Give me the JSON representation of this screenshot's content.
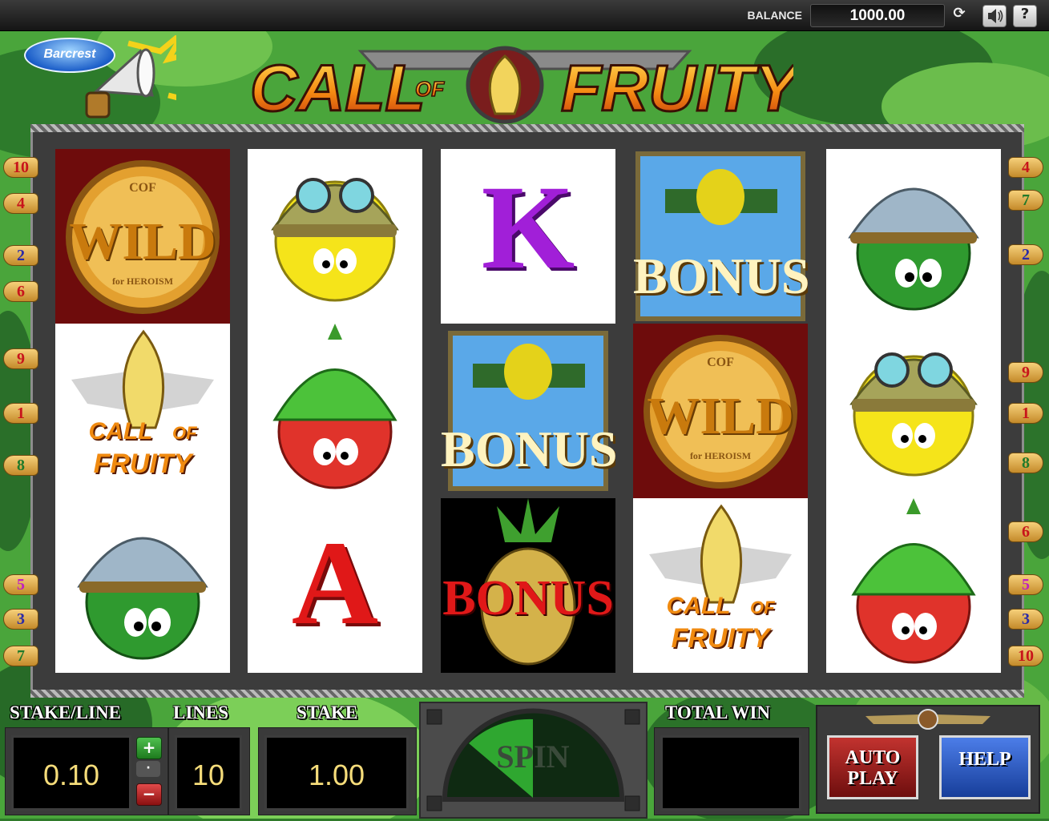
{
  "topbar": {
    "balance_label": "BALANCE",
    "balance_value": "1000.00",
    "icons": [
      "refresh-icon",
      "sound-icon",
      "help-icon"
    ]
  },
  "branding": {
    "provider_logo": "Barcrest",
    "game_title_part1": "CALL",
    "game_title_part2": "OF",
    "game_title_part3": "FRUITY"
  },
  "reels": [
    [
      "wild",
      "call-of-fruity",
      "watermelon-soldier"
    ],
    [
      "lemon-soldier",
      "strawberry-soldier",
      "A"
    ],
    [
      "K",
      "bonus-plane",
      "bonus-pineapple-grenade"
    ],
    [
      "bonus-plane",
      "wild",
      "call-of-fruity"
    ],
    [
      "watermelon-soldier",
      "lemon-soldier",
      "strawberry-soldier"
    ]
  ],
  "symbols": {
    "wild_text": "WILD",
    "wild_top": "COF",
    "wild_bottom": "for HEROISM",
    "bonus_text": "BONUS",
    "logo_call": "CALL",
    "logo_of": "OF",
    "logo_fruity": "FRUITY",
    "letter_k": "K",
    "letter_a": "A"
  },
  "paylines": {
    "left": [
      "10",
      "4",
      "2",
      "6",
      "9",
      "1",
      "8",
      "5",
      "3",
      "7"
    ],
    "right": [
      "4",
      "7",
      "2",
      "9",
      "1",
      "8",
      "6",
      "5",
      "3",
      "10"
    ],
    "colors": {
      "1": "#c8141b",
      "2": "#2a2aa8",
      "3": "#2a2aa8",
      "4": "#c8141b",
      "5": "#c01fc0",
      "6": "#c8141b",
      "7": "#207a2a",
      "8": "#207a2a",
      "9": "#c8141b",
      "10": "#c8141b"
    }
  },
  "controls": {
    "stake_line_label": "STAKE/LINE",
    "stake_line_value": "0.10",
    "lines_label": "LINES",
    "lines_value": "10",
    "stake_label": "STAKE",
    "stake_value": "1.00",
    "total_win_label": "TOTAL WIN",
    "total_win_value": "",
    "spin_label": "SPIN",
    "autoplay_label_1": "AUTO",
    "autoplay_label_2": "PLAY",
    "help_label": "HELP"
  },
  "colors": {
    "display_text": "#f5dc7a",
    "autoplay_button": "#9a1c1c",
    "help_button": "#1f4fb8",
    "camo_light": "#4aa53b",
    "camo_dark": "#1e5a22"
  }
}
